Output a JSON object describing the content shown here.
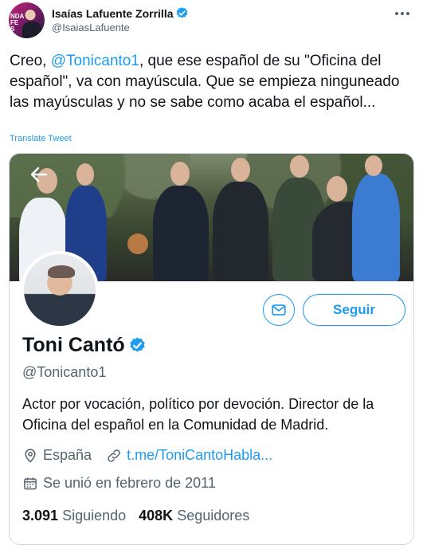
{
  "author": {
    "name": "Isaías Lafuente Zorrilla",
    "handle": "@IsaiasLafuente",
    "avatar_tag": "NDA\nFE\nS"
  },
  "tweet": {
    "text_before": "Creo, ",
    "mention": "@Tonicanto1",
    "text_after": ", que ese español de su \"Oficina del español\", va con mayúscula. Que se empieza ninguneado las mayúsculas y no se sabe como acaba el español...",
    "translate_label": "Translate Tweet"
  },
  "profile_card": {
    "name": "Toni Cantó",
    "handle": "@Tonicanto1",
    "bio": "Actor por vocación, político por devoción. Director de la Oficina del español en la Comunidad de Madrid.",
    "location": "España",
    "website": "t.me/ToniCantoHabla...",
    "joined": "Se unió en febrero de 2011",
    "following_count": "3.091",
    "following_label": "Siguiendo",
    "followers_count": "408K",
    "followers_label": "Seguidores",
    "follow_button": "Seguir"
  },
  "colors": {
    "accent": "#1d9bf0",
    "text": "#0f1419",
    "secondary_text": "#536471",
    "border": "#cfd9de"
  },
  "icons": {
    "verified": "verified-badge-icon",
    "more": "more-icon",
    "back": "back-arrow-icon",
    "mail": "mail-icon",
    "location": "location-pin-icon",
    "link": "link-icon",
    "calendar": "calendar-icon"
  }
}
